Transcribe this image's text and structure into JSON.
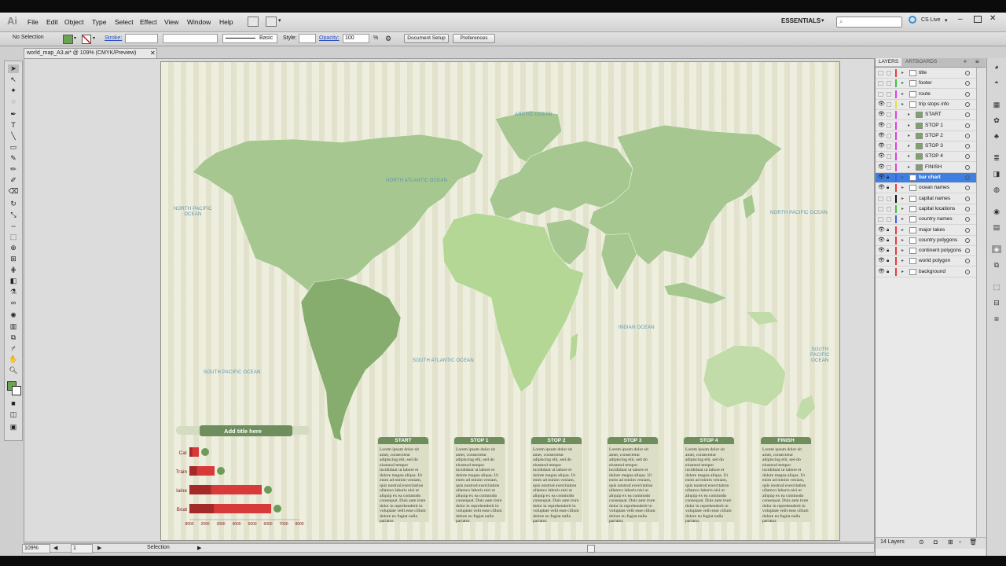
{
  "app": {
    "logo": "Ai",
    "workspace": "ESSENTIALS",
    "search_placeholder": "",
    "cs_live": "CS Live"
  },
  "menu": [
    "File",
    "Edit",
    "Object",
    "Type",
    "Select",
    "Effect",
    "View",
    "Window",
    "Help"
  ],
  "control_bar": {
    "selection": "No Selection",
    "stroke_label": "Stroke:",
    "stroke_value": "",
    "brush_label": "Basic",
    "style_label": "Style:",
    "opacity_label": "Opacity:",
    "opacity_value": "100",
    "opacity_unit": "%",
    "doc_setup": "Document Setup",
    "preferences": "Preferences"
  },
  "document": {
    "tab_title": "world_map_A3.ai* @ 109% (CMYK/Preview)"
  },
  "map": {
    "oceans": [
      "ARCTIC OCEAN",
      "NORTH ATLANTIC OCEAN",
      "NORTH PACIFIC\nOCEAN",
      "NORTH PACIFIC OCEAN",
      "INDIAN OCEAN",
      "SOUTH ATLANTIC OCEAN",
      "SOUTH PACIFIC OCEAN",
      "SOUTH\nPACIFIC\nOCEAN"
    ]
  },
  "chart_data": {
    "type": "bar",
    "title": "Add title here",
    "categories": [
      "Car",
      "Train",
      "Airplaine",
      "Boat"
    ],
    "values": [
      1600,
      2600,
      5600,
      6200
    ],
    "xticks": [
      "8000",
      "2000",
      "3000",
      "4000",
      "5000",
      "6000",
      "7000",
      "8000"
    ],
    "xlim": [
      1000,
      8000
    ],
    "color": "#d83a3a"
  },
  "stops": [
    {
      "title": "START",
      "text": "Lorem ipsum dolor sit amet, consectetur adipiscing elit, sed do eiusmod tempor incididunt ut labore et dolore magna aliqua. Ut enim ad minim veniam, quis nostrud exercitation ullamco laboris nisi ut aliquip ex ea commodo consequat. Duis aute irure dolor in reprehenderit in voluptate velit esse cillum dolore eu fugiat nulla pariatur."
    },
    {
      "title": "STOP 1",
      "text": "Lorem ipsum dolor sit amet, consectetur adipiscing elit, sed do eiusmod tempor incididunt ut labore et dolore magna aliqua. Ut enim ad minim veniam, quis nostrud exercitation ullamco laboris nisi ut aliquip ex ea commodo consequat. Duis aute irure dolor in reprehenderit in voluptate velit esse cillum dolore eu fugiat nulla pariatur."
    },
    {
      "title": "STOP 2",
      "text": "Lorem ipsum dolor sit amet, consectetur adipiscing elit, sed do eiusmod tempor incididunt ut labore et dolore magna aliqua. Ut enim ad minim veniam, quis nostrud exercitation ullamco laboris nisi ut aliquip ex ea commodo consequat. Duis aute irure dolor in reprehenderit in voluptate velit esse cillum dolore eu fugiat nulla pariatur."
    },
    {
      "title": "STOP 3",
      "text": "Lorem ipsum dolor sit amet, consectetur adipiscing elit, sed do eiusmod tempor incididunt ut labore et dolore magna aliqua. Ut enim ad minim veniam, quis nostrud exercitation ullamco laboris nisi ut aliquip ex ea commodo consequat. Duis aute irure dolor in reprehenderit in voluptate velit esse cillum dolore eu fugiat nulla pariatur."
    },
    {
      "title": "STOP 4",
      "text": "Lorem ipsum dolor sit amet, consectetur adipiscing elit, sed do eiusmod tempor incididunt ut labore et dolore magna aliqua. Ut enim ad minim veniam, quis nostrud exercitation ullamco laboris nisi ut aliquip ex ea commodo consequat. Duis aute irure dolor in reprehenderit in voluptate velit esse cillum dolore eu fugiat nulla pariatur."
    },
    {
      "title": "FINISH",
      "text": "Lorem ipsum dolor sit amet, consectetur adipiscing elit, sed do eiusmod tempor incididunt ut labore et dolore magna aliqua. Ut enim ad minim veniam, quis nostrud exercitation ullamco laboris nisi ut aliquip ex ea commodo consequat. Duis aute irure dolor in reprehenderit in voluptate velit esse cillum dolore eu fugiat nulla pariatur."
    }
  ],
  "layers_panel": {
    "tabs": [
      "LAYERS",
      "ARTBOARDS"
    ],
    "count": "14 Layers",
    "layers": [
      {
        "name": "title",
        "color": "#e04040",
        "visible": false,
        "locked": false,
        "selected": false,
        "sub": false
      },
      {
        "name": "footer",
        "color": "#40c040",
        "visible": false,
        "locked": false,
        "selected": false,
        "sub": false
      },
      {
        "name": "route",
        "color": "#e040e0",
        "visible": false,
        "locked": false,
        "selected": false,
        "sub": false
      },
      {
        "name": "trip stops info",
        "color": "#e0e040",
        "visible": true,
        "locked": false,
        "selected": false,
        "sub": false
      },
      {
        "name": "START",
        "color": "#e040e0",
        "visible": true,
        "locked": false,
        "selected": false,
        "sub": true
      },
      {
        "name": "STOP 1",
        "color": "#e040e0",
        "visible": true,
        "locked": false,
        "selected": false,
        "sub": true
      },
      {
        "name": "STOP 2",
        "color": "#e040e0",
        "visible": true,
        "locked": false,
        "selected": false,
        "sub": true
      },
      {
        "name": "STOP 3",
        "color": "#e040e0",
        "visible": true,
        "locked": false,
        "selected": false,
        "sub": true
      },
      {
        "name": "STOP 4",
        "color": "#e040e0",
        "visible": true,
        "locked": false,
        "selected": false,
        "sub": true
      },
      {
        "name": "FINISH",
        "color": "#e040e0",
        "visible": true,
        "locked": false,
        "selected": false,
        "sub": true
      },
      {
        "name": "bar chart",
        "color": "#4060e0",
        "visible": true,
        "locked": true,
        "selected": true,
        "sub": false
      },
      {
        "name": "ocean names",
        "color": "#e04040",
        "visible": true,
        "locked": true,
        "selected": false,
        "sub": false
      },
      {
        "name": "capital names",
        "color": "#111111",
        "visible": false,
        "locked": false,
        "selected": false,
        "sub": false
      },
      {
        "name": "capital locations",
        "color": "#40c040",
        "visible": false,
        "locked": false,
        "selected": false,
        "sub": false
      },
      {
        "name": "country names",
        "color": "#4060e0",
        "visible": false,
        "locked": false,
        "selected": false,
        "sub": false
      },
      {
        "name": "major lakes",
        "color": "#e04040",
        "visible": true,
        "locked": true,
        "selected": false,
        "sub": false
      },
      {
        "name": "country polygons",
        "color": "#e04040",
        "visible": true,
        "locked": true,
        "selected": false,
        "sub": false
      },
      {
        "name": "continent polygons",
        "color": "#e04040",
        "visible": true,
        "locked": true,
        "selected": false,
        "sub": false
      },
      {
        "name": "world polygon",
        "color": "#e04040",
        "visible": true,
        "locked": true,
        "selected": false,
        "sub": false
      },
      {
        "name": "background",
        "color": "#e04040",
        "visible": true,
        "locked": true,
        "selected": false,
        "sub": false
      }
    ]
  },
  "status": {
    "zoom": "109%",
    "page": "1",
    "tool": "Selection"
  }
}
